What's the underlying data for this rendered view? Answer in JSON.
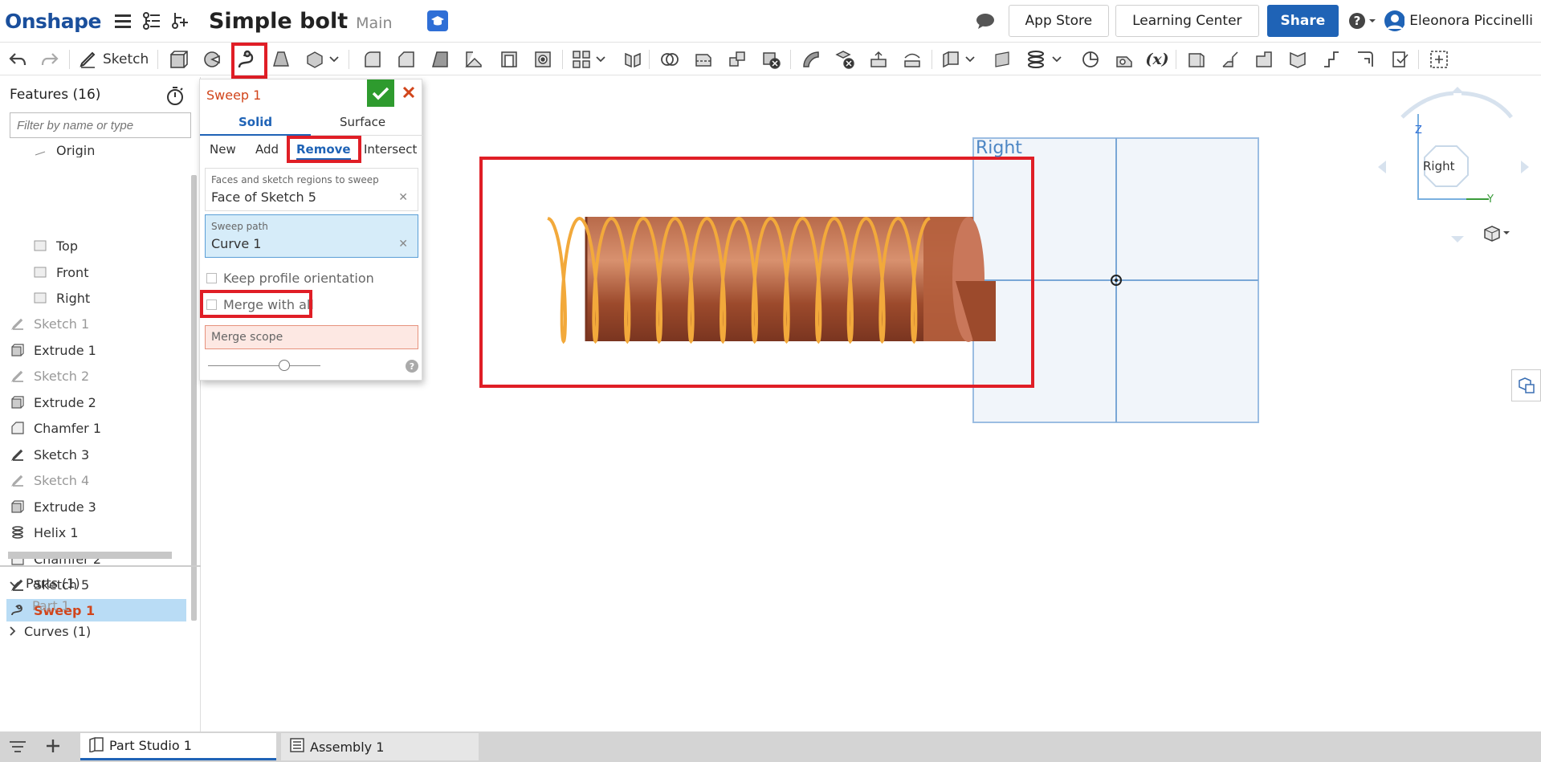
{
  "header": {
    "logo": "Onshape",
    "doc_title": "Simple bolt",
    "branch": "Main",
    "app_store": "App Store",
    "learning_center": "Learning Center",
    "share": "Share",
    "user_name": "Eleonora Piccinelli"
  },
  "toolbar": {
    "sketch_label": "Sketch",
    "variable_label": "(x)"
  },
  "features": {
    "title": "Features (16)",
    "filter_placeholder": "Filter by name or type",
    "items": [
      {
        "label": "Origin",
        "state": "normal"
      },
      {
        "label": "Top",
        "state": "normal"
      },
      {
        "label": "Front",
        "state": "normal"
      },
      {
        "label": "Right",
        "state": "normal"
      },
      {
        "label": "Sketch 1",
        "state": "dim"
      },
      {
        "label": "Extrude 1",
        "state": "normal"
      },
      {
        "label": "Sketch 2",
        "state": "dim"
      },
      {
        "label": "Extrude 2",
        "state": "normal"
      },
      {
        "label": "Chamfer 1",
        "state": "normal"
      },
      {
        "label": "Sketch 3",
        "state": "normal"
      },
      {
        "label": "Sketch 4",
        "state": "dim"
      },
      {
        "label": "Extrude 3",
        "state": "normal"
      },
      {
        "label": "Helix 1",
        "state": "normal"
      },
      {
        "label": "Chamfer 2",
        "state": "normal"
      },
      {
        "label": "Sketch 5",
        "state": "normal"
      },
      {
        "label": "Sweep 1",
        "state": "selected"
      }
    ],
    "parts_header": "Parts (1)",
    "part_item": "Part 1",
    "curves_header": "Curves (1)"
  },
  "dialog": {
    "title": "Sweep 1",
    "tabs": [
      "Solid",
      "Surface"
    ],
    "active_tab": "Solid",
    "operations": [
      "New",
      "Add",
      "Remove",
      "Intersect"
    ],
    "active_operation": "Remove",
    "faces_label": "Faces and sketch regions to sweep",
    "faces_value": "Face of Sketch 5",
    "path_label": "Sweep path",
    "path_value": "Curve 1",
    "keep_orientation": "Keep profile orientation",
    "keep_orientation_checked": false,
    "merge_all": "Merge with all",
    "merge_all_checked": false,
    "merge_scope": "Merge scope",
    "help": "?"
  },
  "viewport": {
    "plane_label": "Right",
    "view_cube_label": "Right",
    "axis_z": "Z",
    "axis_y": "Y"
  },
  "tabs_bottom": {
    "tab1": "Part Studio 1",
    "tab2": "Assembly 1"
  },
  "colors": {
    "brand": "#1a4f9c",
    "share": "#1f63b6",
    "highlight": "#e01e26",
    "feature_selected_text": "#d1451b",
    "helix": "#f2a93b",
    "bolt": "#a0492a"
  }
}
